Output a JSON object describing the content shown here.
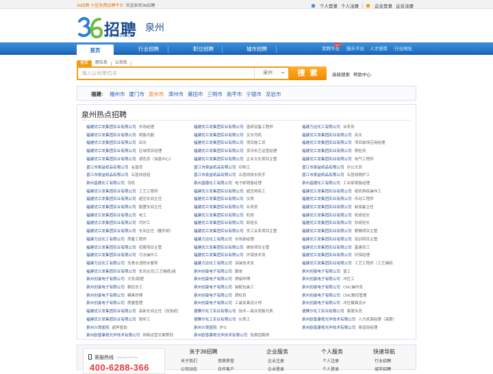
{
  "topbar": {
    "brand_prefix": "36招聘",
    "brand_slogan": "大型免费招聘平台",
    "welcome": "欢迎来到36招聘",
    "links": [
      "个人登录",
      "个人注册",
      "企业登录",
      "企业注册"
    ]
  },
  "logo": {
    "brand": "招聘",
    "url": "WWW.36.CN",
    "city": "泉州"
  },
  "nav": {
    "items": [
      "首页",
      "行业招聘",
      "职位招聘",
      "城市招聘"
    ],
    "right_links": [
      "营聘平台",
      "猎头平台",
      "人才容库",
      "行业网址"
    ],
    "hot_badge": "HOT"
  },
  "search": {
    "tabs": [
      "全文",
      "职位名",
      "公司名"
    ],
    "placeholder": "输入公司/职位名",
    "city": "泉州",
    "button": "搜 索",
    "advanced": "高级搜索",
    "help": "帮助中心"
  },
  "region": {
    "label": "福建:",
    "cities": [
      "福州市",
      "厦门市",
      "泉州市",
      "漳州市",
      "莆田市",
      "三明市",
      "南平市",
      "宁德市",
      "龙岩市"
    ],
    "current": "泉州市"
  },
  "hot": {
    "title": "泉州热点招聘",
    "rows": [
      [
        [
          "福建优兰发集团实业有限公司",
          "市场经理"
        ],
        [
          "福建优兰发集团实业有限公司",
          "造纸设备工程师"
        ],
        [
          "福建万达化工有限公司",
          "业务员"
        ]
      ],
      [
        [
          "福建优兰发集团实业有限公司",
          "销售内勤"
        ],
        [
          "福建优兰发集团实业有限公司",
          "叉车司机"
        ],
        [
          "福建优兰发集团实业有限公司",
          "店长"
        ]
      ],
      [
        [
          "福建优兰发集团实业有限公司",
          "店长"
        ],
        [
          "福建优兰发集团实业有限公司",
          "项目施工员"
        ],
        [
          "福建优兰发集团实业有限公司",
          "项目装饰应用经理"
        ]
      ],
      [
        [
          "福建优兰发集团实业有限公司",
          "区域项目经理"
        ],
        [
          "福建优兰发集团实业有限公司",
          "货币布艺运营经理"
        ],
        [
          "福建优兰发集团实业有限公司",
          "质检员"
        ]
      ],
      [
        [
          "福建优兰发集团实业有限公司",
          "调色员（油墨中心）"
        ],
        [
          "福建优兰发集团实业有限公司",
          "企业文化项目主管"
        ],
        [
          "福建优兰发集团实业有限公司",
          "电气工程师"
        ]
      ],
      [
        [
          "晋江市泉益纸品有限公司",
          "会普员"
        ],
        [
          "晋江市泉益纸品有限公司",
          "印刷工"
        ],
        [
          "晋江市泉益纸品有限公司",
          "办公文员"
        ]
      ],
      [
        [
          "晋江市泉益纸品有限公司",
          "五层线班组"
        ],
        [
          "晋江市泉益纸品有限公司",
          "五层线体长机手"
        ],
        [
          "晋江市泉益纸品有限公司",
          "五层线锅炉工"
        ]
      ],
      [
        [
          "泉州昌德化工有限公司",
          "司机"
        ],
        [
          "泉州昌德化工有限公司",
          "电子邮销售经理"
        ],
        [
          "泉州昌德化工有限公司",
          "工业部销售经理"
        ]
      ],
      [
        [
          "福建优兰发集团实业有限公司",
          "工艺工程师"
        ],
        [
          "福建优兰发集团实业有限公司",
          "超压熟练工"
        ],
        [
          "福建优兰发集团实业有限公司",
          "纸机熟练操作工"
        ]
      ],
      [
        [
          "福建优兰发集团实业有限公司",
          "超压车间主任"
        ],
        [
          "福建优兰发集团实业有限公司",
          "仪表"
        ],
        [
          "福建优兰发集团实业有限公司",
          "传动工程师"
        ]
      ],
      [
        [
          "福建优兰发集团实业有限公司",
          "服置车间主任"
        ],
        [
          "福建优兰发集团实业有限公司",
          "业务员"
        ],
        [
          "福建优兰发集团实业有限公司",
          "制浆副主任"
        ]
      ],
      [
        [
          "福建优兰发集团实业有限公司",
          "电工"
        ],
        [
          "福建优兰发集团实业有限公司",
          "机修"
        ],
        [
          "福建优兰发集团实业有限公司",
          "机修班长"
        ]
      ],
      [
        [
          "福建优兰发集团实业有限公司",
          "司炉工"
        ],
        [
          "福建优兰发集团实业有限公司",
          "卸班长"
        ],
        [
          "福建优兰发集团实业有限公司",
          "钞纸班长"
        ]
      ],
      [
        [
          "福建优兰发集团实业有限公司",
          "车间主任（覆页纸）"
        ],
        [
          "福建优兰发集团实业有限公司",
          "员工关系项目主管"
        ],
        [
          "福建优兰发集团实业有限公司",
          "薪酬项目主管"
        ]
      ],
      [
        [
          "福建万达化工有限公司",
          "质量工程师"
        ],
        [
          "福建万达化工有限公司",
          "市场部经理"
        ],
        [
          "福建优兰发集团实业有限公司",
          "培训项目主管"
        ]
      ],
      [
        [
          "福建优兰发集团实业有限公司",
          "招聘项目主管"
        ],
        [
          "福建优兰发集团实业有限公司",
          "绩效项目主管"
        ],
        [
          "福建优兰发集团实业有限公司",
          "基建员工"
        ]
      ],
      [
        [
          "福建优兰发集团实业有限公司",
          "污水操作工"
        ],
        [
          "福建优兰发集团实业有限公司",
          "环保技术员"
        ],
        [
          "福建优兰发集团实业有限公司",
          "环保经理"
        ]
      ],
      [
        [
          "福建万达化工有限公司",
          "负责水消除水服务"
        ],
        [
          "福建万达化工有限公司",
          "涂装技术员"
        ],
        [
          "福建优兰发集团实业有限公司",
          "工艺工程师（工艺编纸"
        ]
      ],
      [
        [
          "福建优兰发集团实业有限公司",
          "车间主任(工艺编纸)组"
        ],
        [
          "泉州创姿电子有限公司",
          "跟单"
        ],
        [
          "泉州创姿电子有限公司",
          "普工"
        ]
      ],
      [
        [
          "泉州创姿电子有限公司",
          "文员/助理"
        ],
        [
          "泉州创姿电子有限公司",
          "焊接师傅"
        ],
        [
          "泉州创姿电子有限公司",
          "冲压工"
        ]
      ],
      [
        [
          "泉州创姿电子有限公司",
          "数控车工"
        ],
        [
          "泉州创姿电子有限公司",
          "装配包装工"
        ],
        [
          "泉州创姿电子有限公司",
          "CNC操作员"
        ]
      ],
      [
        [
          "泉州创姿电子有限公司",
          "模具师傅"
        ],
        [
          "泉州创姿电子有限公司",
          "质检员"
        ],
        [
          "泉州创姿电子有限公司",
          "CNC数控管理"
        ]
      ],
      [
        [
          "泉州创姿电子有限公司",
          "质量管理"
        ],
        [
          "泉州创姿电子有限公司",
          "工装夹具设计师"
        ],
        [
          "泉州创姿电子有限公司",
          "冲压模具设计"
        ]
      ],
      [
        [
          "福建优兰发集团实业有限公司",
          "高新车间主任（双张纸）"
        ],
        [
          "德赛尔化工实业有限公司",
          "技术—商业销售代表"
        ],
        [
          "德赛尔化工实业有限公司",
          "客服专员"
        ]
      ],
      [
        [
          "福建优兰发集团实业有限公司",
          "厕所工"
        ],
        [
          "德赛尔化工实业有限公司",
          "仪表工"
        ],
        [
          "泉州欧普康视光学技术有限公司",
          "人力资源经理（高薪）"
        ]
      ],
      [
        [
          "泉州兴贤医院",
          "超声医助"
        ],
        [
          "泉州兴贤医院",
          "护士"
        ],
        [
          "泉州欧普康视光学技术有限公司",
          "渠道部经理"
        ]
      ],
      [
        [
          "泉州欧普康视光学技术有限公司",
          "网络运营文案策划"
        ],
        [
          "泉州欧普康视光学技术有限公司",
          "免费招聘师"
        ],
        [
          "",
          ""
        ]
      ]
    ]
  },
  "footer": {
    "hotline_title": "客服热线",
    "hotline_en": "Customer Service",
    "hotline_number": "400-6288-366",
    "cols": [
      {
        "title": "关于36招聘",
        "links": [
          "关于我们",
          "资质荣誉",
          "公司动态",
          "合作客户"
        ]
      },
      {
        "title": "企业服务",
        "links": [
          "企业注册",
          "企业登录"
        ]
      },
      {
        "title": "个人服务",
        "links": [
          "个人注册",
          "个人登录"
        ]
      },
      {
        "title": "快速导航",
        "links": [
          "行业招聘",
          "城市招聘"
        ]
      }
    ]
  },
  "colors": {
    "nav_blue": "#1e6cc0",
    "search_orange": "#f39c12",
    "link_blue": "#2a4f9a",
    "current_city": "#f07a10",
    "hotline_red": "#e33333"
  }
}
